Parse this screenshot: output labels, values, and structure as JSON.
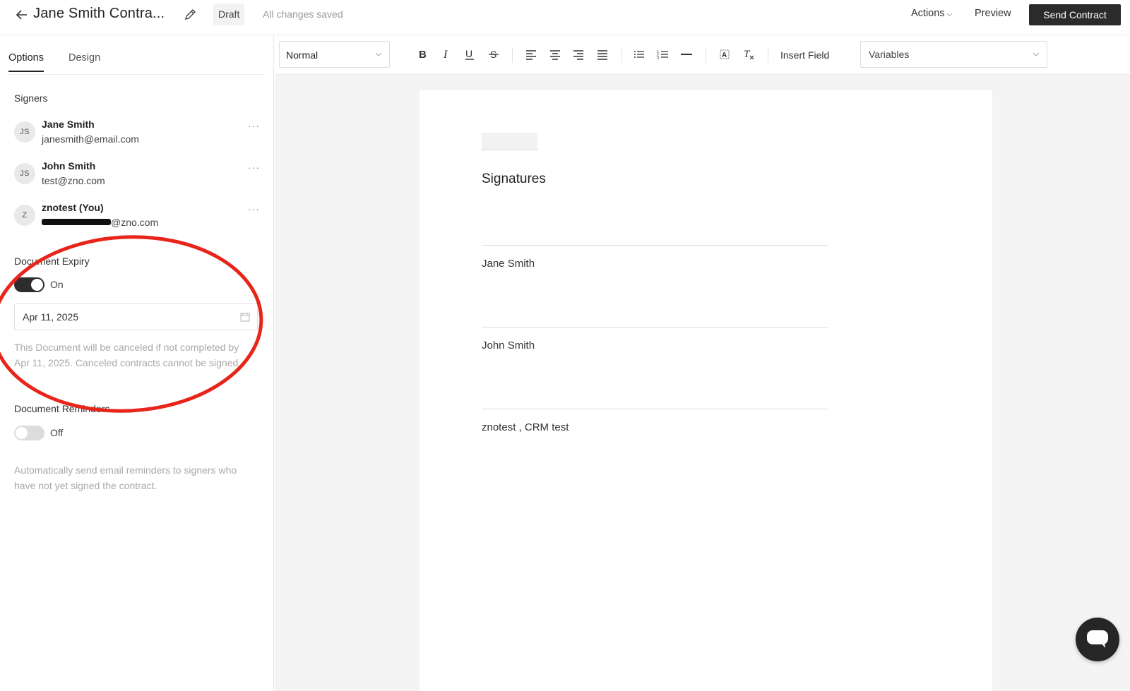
{
  "header": {
    "title": "Jane Smith Contra...",
    "status_badge": "Draft",
    "save_status": "All changes saved",
    "actions_label": "Actions",
    "preview_label": "Preview",
    "send_label": "Send Contract"
  },
  "sidebar": {
    "tabs": [
      {
        "label": "Options",
        "active": true
      },
      {
        "label": "Design",
        "active": false
      }
    ],
    "signers_label": "Signers",
    "signers": [
      {
        "initials": "JS",
        "name": "Jane Smith",
        "email": "janesmith@email.com"
      },
      {
        "initials": "JS",
        "name": "John Smith",
        "email": "test@zno.com"
      },
      {
        "initials": "Z",
        "name": "znotest (You)",
        "email_visible": "@zno.com"
      }
    ],
    "more_glyph": "···",
    "expiry": {
      "label": "Document Expiry",
      "toggle_state": "On",
      "date": "Apr 11, 2025",
      "help": "This Document will be canceled if not completed by Apr 11, 2025. Canceled contracts cannot be signed."
    },
    "reminders": {
      "label": "Document Reminders",
      "toggle_state": "Off",
      "help": "Automatically send email reminders to signers who have not yet signed the contract."
    }
  },
  "toolbar": {
    "text_style": "Normal",
    "insert_field": "Insert Field",
    "variables": "Variables"
  },
  "document": {
    "heading": "Signatures",
    "signature_names": [
      "Jane Smith",
      "John Smith",
      "znotest , CRM test"
    ]
  },
  "colors": {
    "primary_button": "#2b2b2b",
    "annotation": "#e8251a"
  }
}
